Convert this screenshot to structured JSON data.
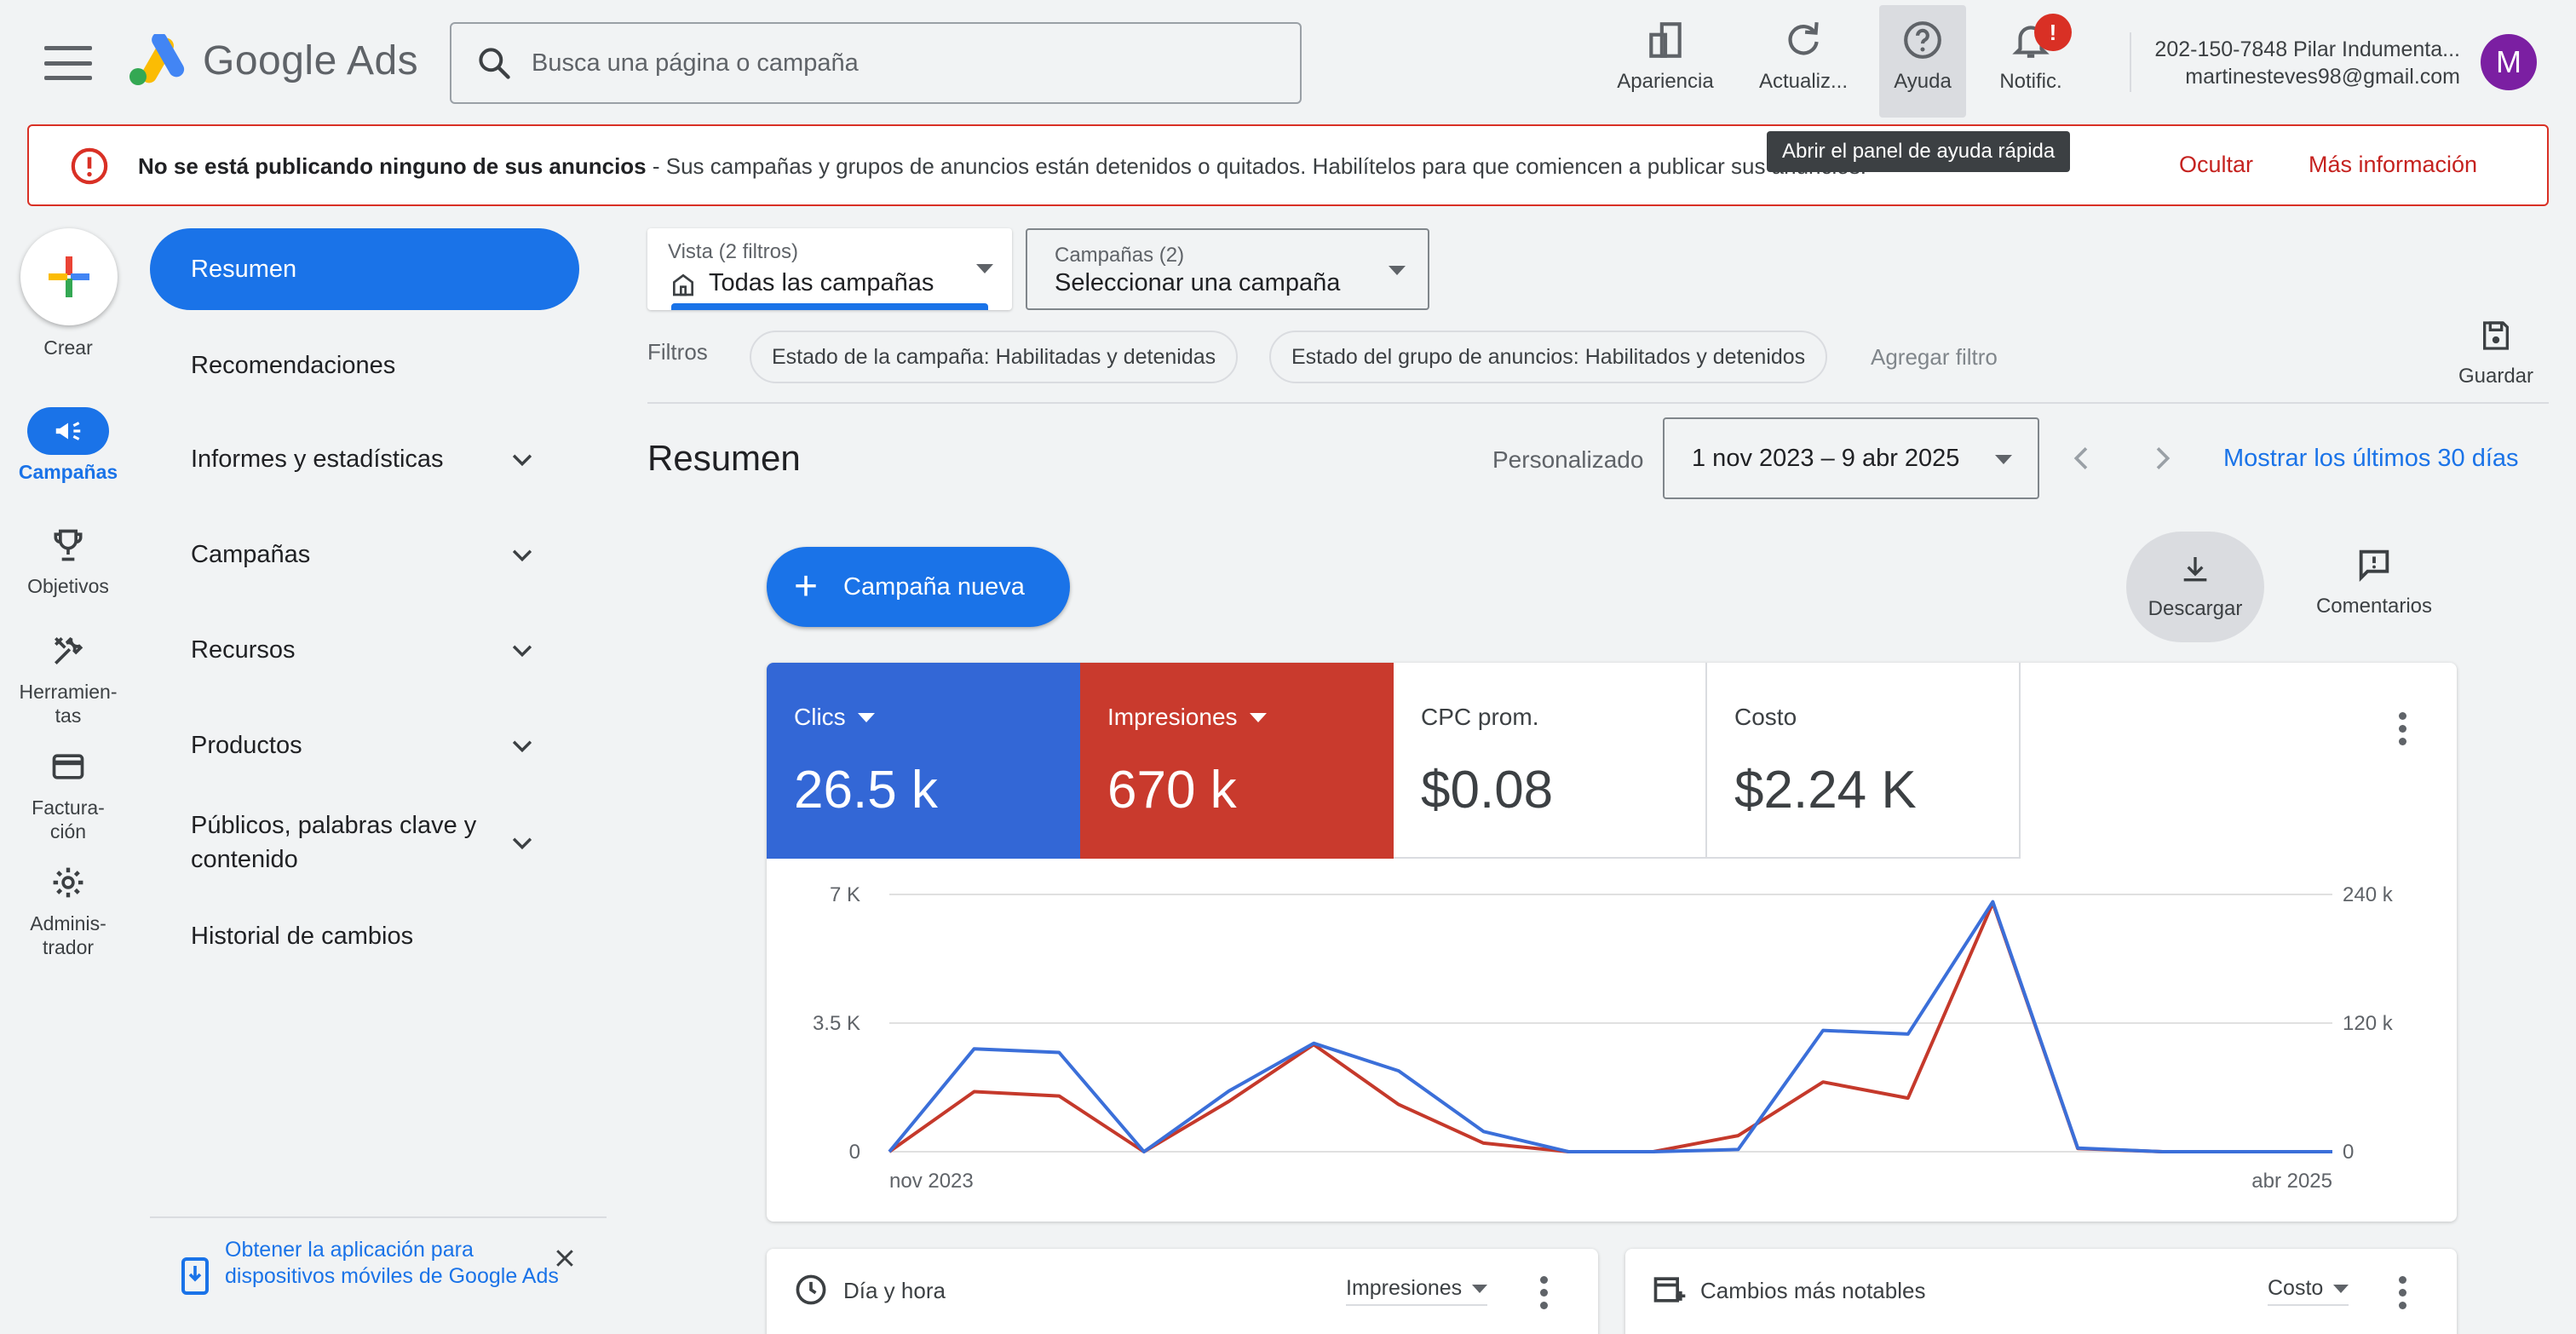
{
  "header": {
    "logo_text": "Google Ads",
    "search_placeholder": "Busca una página o campaña",
    "tools": [
      {
        "label": "Apariencia",
        "icon": "appearance-icon"
      },
      {
        "label": "Actualiz...",
        "icon": "refresh-icon"
      },
      {
        "label": "Ayuda",
        "icon": "help-icon"
      },
      {
        "label": "Notific.",
        "icon": "bell-icon"
      }
    ],
    "notification_badge": "!",
    "account_line1": "202-150-7848 Pilar Indumenta...",
    "account_line2": "martinesteves98@gmail.com",
    "avatar_letter": "M"
  },
  "alert": {
    "bold": "No se está publicando ninguno de sus anuncios",
    "text": " - Sus campañas y grupos de anuncios están detenidos o quitados. Habilítelos para que comiencen a publicar sus anuncios.",
    "hide": "Ocultar",
    "more": "Más información"
  },
  "tooltip": "Abrir el panel de ayuda rápida",
  "rail": {
    "create": "Crear",
    "items": [
      {
        "label": "Campañas",
        "icon": "megaphone-icon",
        "active": true
      },
      {
        "label": "Objetivos",
        "icon": "trophy-icon"
      },
      {
        "label": "Herramien-\ntas",
        "icon": "tools-icon"
      },
      {
        "label": "Factura-\nción",
        "icon": "credit-card-icon"
      },
      {
        "label": "Adminis-\ntrador",
        "icon": "gear-icon"
      }
    ]
  },
  "nav": {
    "items": [
      {
        "label": "Resumen",
        "active": true
      },
      {
        "label": "Recomendaciones"
      },
      {
        "label": "Informes y estadísticas",
        "expand": true
      },
      {
        "label": "Campañas",
        "expand": true
      },
      {
        "label": "Recursos",
        "expand": true
      },
      {
        "label": "Productos",
        "expand": true
      },
      {
        "label": "Públicos, palabras clave y contenido",
        "expand": true
      },
      {
        "label": "Historial de cambios"
      }
    ],
    "app_promo": "Obtener la aplicación para dispositivos móviles de Google Ads"
  },
  "filters": {
    "view_small": "Vista (2 filtros)",
    "view_big": "Todas las campañas",
    "campaigns_small": "Campañas (2)",
    "campaigns_big": "Seleccionar una campaña",
    "label": "Filtros",
    "chips": [
      "Estado de la campaña: Habilitadas y detenidas",
      "Estado del grupo de anuncios: Habilitados y detenidos"
    ],
    "add_filter": "Agregar filtro",
    "save": "Guardar"
  },
  "overview": {
    "title": "Resumen",
    "custom_label": "Personalizado",
    "date_range": "1 nov 2023 – 9 abr 2025",
    "last30": "Mostrar los últimos 30 días",
    "new_campaign": "Campaña nueva",
    "download": "Descargar",
    "comments": "Comentarios"
  },
  "metrics": [
    {
      "name": "Clics",
      "value": "26.5 k",
      "color": "#3367d6"
    },
    {
      "name": "Impresiones",
      "value": "670 k",
      "color": "#c93a2d"
    },
    {
      "name": "CPC prom.",
      "value": "$0.08"
    },
    {
      "name": "Costo",
      "value": "$2.24 K"
    }
  ],
  "chart_data": {
    "type": "line",
    "x_start_label": "nov 2023",
    "x_end_label": "abr 2025",
    "left_ticks": [
      "0",
      "3.5 K",
      "7 K"
    ],
    "right_ticks": [
      "0",
      "120 k",
      "240 k"
    ],
    "ylim_left": [
      0,
      7000
    ],
    "ylim_right": [
      0,
      240000
    ],
    "grid": true,
    "series": [
      {
        "name": "Clics",
        "axis": "left",
        "color": "#3b6fd9",
        "values": [
          0,
          2800,
          2700,
          0,
          1650,
          2950,
          2200,
          550,
          0,
          0,
          60,
          3300,
          3200,
          6800,
          100,
          0,
          0,
          0
        ]
      },
      {
        "name": "Impresiones",
        "axis": "right",
        "color": "#c5392b",
        "values": [
          0,
          56000,
          52000,
          0,
          47000,
          100000,
          44000,
          8000,
          0,
          0,
          15000,
          65000,
          50000,
          232000,
          3000,
          0,
          0,
          0
        ]
      }
    ]
  },
  "bottom_cards": [
    {
      "title": "Día y hora",
      "select": "Impresiones",
      "icon": "clock-icon"
    },
    {
      "title": "Cambios más notables",
      "select": "Costo",
      "icon": "changes-icon"
    }
  ]
}
